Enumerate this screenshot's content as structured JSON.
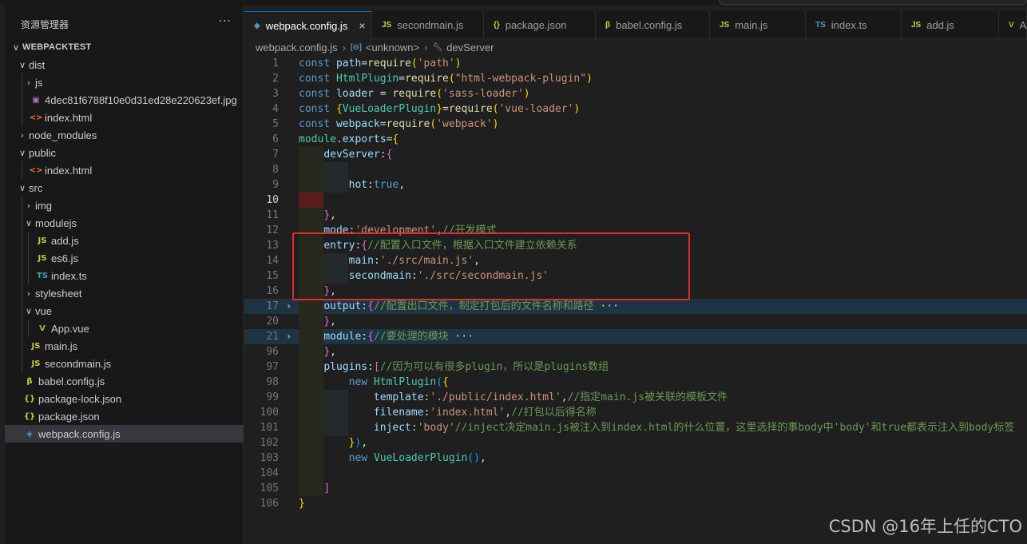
{
  "explorer": {
    "title": "资源管理器",
    "more": "···",
    "tree": [
      {
        "label": "WEBPACKTEST",
        "chev": "∨",
        "icon": "",
        "depth": 0,
        "root": true
      },
      {
        "label": "dist",
        "chev": "∨",
        "icon": "",
        "depth": 1
      },
      {
        "label": "js",
        "chev": "›",
        "icon": "",
        "depth": 2
      },
      {
        "label": "4dec81f6788f10e0d31ed28e220623ef.jpg",
        "chev": "",
        "icon": "▣",
        "iconColor": "#a074c4",
        "depth": 2
      },
      {
        "label": "index.html",
        "chev": "",
        "icon": "<>",
        "iconColor": "#e37933",
        "depth": 2
      },
      {
        "label": "node_modules",
        "chev": "›",
        "icon": "",
        "depth": 1
      },
      {
        "label": "public",
        "chev": "∨",
        "icon": "",
        "depth": 1
      },
      {
        "label": "index.html",
        "chev": "",
        "icon": "<>",
        "iconColor": "#e37933",
        "depth": 2
      },
      {
        "label": "src",
        "chev": "∨",
        "icon": "",
        "depth": 1
      },
      {
        "label": "img",
        "chev": "›",
        "icon": "",
        "depth": 2
      },
      {
        "label": "modulejs",
        "chev": "∨",
        "icon": "",
        "depth": 2
      },
      {
        "label": "add.js",
        "chev": "",
        "icon": "JS",
        "iconColor": "#cbcb41",
        "depth": 3
      },
      {
        "label": "es6.js",
        "chev": "",
        "icon": "JS",
        "iconColor": "#cbcb41",
        "depth": 3
      },
      {
        "label": "index.ts",
        "chev": "",
        "icon": "TS",
        "iconColor": "#519aba",
        "depth": 3
      },
      {
        "label": "stylesheet",
        "chev": "›",
        "icon": "",
        "depth": 2
      },
      {
        "label": "vue",
        "chev": "∨",
        "icon": "",
        "depth": 2
      },
      {
        "label": "App.vue",
        "chev": "",
        "icon": "V",
        "iconColor": "#8dc149",
        "depth": 3
      },
      {
        "label": "main.js",
        "chev": "",
        "icon": "JS",
        "iconColor": "#cbcb41",
        "depth": 2
      },
      {
        "label": "secondmain.js",
        "chev": "",
        "icon": "JS",
        "iconColor": "#cbcb41",
        "depth": 2
      },
      {
        "label": "babel.config.js",
        "chev": "",
        "icon": "β",
        "iconColor": "#cbcb41",
        "depth": 1
      },
      {
        "label": "package-lock.json",
        "chev": "",
        "icon": "{}",
        "iconColor": "#cbcb41",
        "depth": 1
      },
      {
        "label": "package.json",
        "chev": "",
        "icon": "{}",
        "iconColor": "#cbcb41",
        "depth": 1
      },
      {
        "label": "webpack.config.js",
        "chev": "",
        "icon": "◈",
        "iconColor": "#519aba",
        "depth": 1,
        "selected": true
      }
    ]
  },
  "tabs": [
    {
      "label": "webpack.config.js",
      "icon": "◈",
      "iconColor": "#519aba",
      "active": true,
      "close": "×"
    },
    {
      "label": "secondmain.js",
      "icon": "JS",
      "iconColor": "#cbcb41"
    },
    {
      "label": "package.json",
      "icon": "{}",
      "iconColor": "#cbcb41"
    },
    {
      "label": "babel.config.js",
      "icon": "β",
      "iconColor": "#cbcb41"
    },
    {
      "label": "main.js",
      "icon": "JS",
      "iconColor": "#cbcb41"
    },
    {
      "label": "index.ts",
      "icon": "TS",
      "iconColor": "#519aba"
    },
    {
      "label": "add.js",
      "icon": "JS",
      "iconColor": "#cbcb41"
    },
    {
      "label": "A",
      "icon": "V",
      "iconColor": "#8dc149"
    }
  ],
  "breadcrumb": {
    "file": "webpack.config.js",
    "symbol": "<unknown>",
    "prop": "devServer"
  },
  "editor": {
    "current_line": "10",
    "lines": [
      {
        "n": "1",
        "fold": "",
        "tokens": [
          [
            "kw",
            "const "
          ],
          [
            "var",
            "path"
          ],
          [
            "pl",
            "="
          ],
          [
            "fn",
            "require"
          ],
          [
            "br1",
            "("
          ],
          [
            "str",
            "'path'"
          ],
          [
            "br1",
            ")"
          ]
        ]
      },
      {
        "n": "2",
        "fold": "",
        "tokens": [
          [
            "kw",
            "const "
          ],
          [
            "cls",
            "HtmlPlugin"
          ],
          [
            "pl",
            "="
          ],
          [
            "fn",
            "require"
          ],
          [
            "br1",
            "("
          ],
          [
            "str",
            "\"html-webpack-plugin\""
          ],
          [
            "br1",
            ")"
          ]
        ]
      },
      {
        "n": "3",
        "fold": "",
        "tokens": [
          [
            "kw",
            "const "
          ],
          [
            "var",
            "loader"
          ],
          [
            "pl",
            " = "
          ],
          [
            "fn",
            "require"
          ],
          [
            "br1",
            "("
          ],
          [
            "str",
            "'sass-loader'"
          ],
          [
            "br1",
            ")"
          ]
        ]
      },
      {
        "n": "4",
        "fold": "",
        "tokens": [
          [
            "kw",
            "const "
          ],
          [
            "br1",
            "{"
          ],
          [
            "cls",
            "VueLoaderPlugin"
          ],
          [
            "br1",
            "}"
          ],
          [
            "pl",
            "="
          ],
          [
            "fn",
            "require"
          ],
          [
            "br1",
            "("
          ],
          [
            "str",
            "'vue-loader'"
          ],
          [
            "br1",
            ")"
          ]
        ]
      },
      {
        "n": "5",
        "fold": "",
        "tokens": [
          [
            "kw",
            "const "
          ],
          [
            "var",
            "webpack"
          ],
          [
            "pl",
            "="
          ],
          [
            "fn",
            "require"
          ],
          [
            "br1",
            "("
          ],
          [
            "str",
            "'webpack'"
          ],
          [
            "br1",
            ")"
          ]
        ]
      },
      {
        "n": "6",
        "fold": "",
        "tokens": [
          [
            "cls",
            "module"
          ],
          [
            "pl",
            "."
          ],
          [
            "var",
            "exports"
          ],
          [
            "pl",
            "="
          ],
          [
            "br1",
            "{"
          ]
        ]
      },
      {
        "n": "7",
        "fold": "",
        "tokens": [
          [
            "pl",
            "    "
          ],
          [
            "var",
            "devServer"
          ],
          [
            "pl",
            ":"
          ],
          [
            "br2",
            "{"
          ]
        ]
      },
      {
        "n": "8",
        "fold": "",
        "tokens": []
      },
      {
        "n": "9",
        "fold": "",
        "tokens": [
          [
            "pl",
            "        "
          ],
          [
            "var",
            "hot"
          ],
          [
            "pl",
            ":"
          ],
          [
            "kw",
            "true"
          ],
          [
            "pl",
            ","
          ]
        ]
      },
      {
        "n": "10",
        "fold": "",
        "tokens": []
      },
      {
        "n": "11",
        "fold": "",
        "tokens": [
          [
            "pl",
            "    "
          ],
          [
            "br2",
            "}"
          ],
          [
            "pl",
            ","
          ]
        ]
      },
      {
        "n": "12",
        "fold": "",
        "tokens": [
          [
            "pl",
            "    "
          ],
          [
            "var",
            "mode"
          ],
          [
            "pl",
            ":"
          ],
          [
            "str",
            "'development'"
          ],
          [
            "pl",
            ","
          ],
          [
            "cmt",
            "//开发模式"
          ]
        ]
      },
      {
        "n": "13",
        "fold": "",
        "tokens": [
          [
            "pl",
            "    "
          ],
          [
            "var",
            "entry"
          ],
          [
            "pl",
            ":"
          ],
          [
            "br2",
            "{"
          ],
          [
            "cmt",
            "//配置入口文件，根据入口文件建立依赖关系"
          ]
        ]
      },
      {
        "n": "14",
        "fold": "",
        "tokens": [
          [
            "pl",
            "        "
          ],
          [
            "var",
            "main"
          ],
          [
            "pl",
            ":"
          ],
          [
            "str",
            "'./src/main.js'"
          ],
          [
            "pl",
            ","
          ]
        ]
      },
      {
        "n": "15",
        "fold": "",
        "tokens": [
          [
            "pl",
            "        "
          ],
          [
            "var",
            "secondmain"
          ],
          [
            "pl",
            ":"
          ],
          [
            "str",
            "'./src/secondmain.js'"
          ]
        ]
      },
      {
        "n": "16",
        "fold": "",
        "tokens": [
          [
            "pl",
            "    "
          ],
          [
            "br2",
            "}"
          ],
          [
            "pl",
            ","
          ]
        ]
      },
      {
        "n": "17",
        "fold": "›",
        "hl": true,
        "tokens": [
          [
            "pl",
            "    "
          ],
          [
            "var",
            "output"
          ],
          [
            "pl",
            ":"
          ],
          [
            "br2",
            "{"
          ],
          [
            "cmt",
            "//配置出口文件，制定打包后的文件名称和路径"
          ],
          [
            "pl",
            " ···"
          ]
        ]
      },
      {
        "n": "20",
        "fold": "",
        "tokens": [
          [
            "pl",
            "    "
          ],
          [
            "br2",
            "}"
          ],
          [
            "pl",
            ","
          ]
        ]
      },
      {
        "n": "21",
        "fold": "›",
        "hl": true,
        "tokens": [
          [
            "pl",
            "    "
          ],
          [
            "var",
            "module"
          ],
          [
            "pl",
            ":"
          ],
          [
            "br2",
            "{"
          ],
          [
            "cmt",
            "//要处理的模块"
          ],
          [
            "pl",
            " ···"
          ]
        ]
      },
      {
        "n": "96",
        "fold": "",
        "tokens": [
          [
            "pl",
            "    "
          ],
          [
            "br2",
            "}"
          ],
          [
            "pl",
            ","
          ]
        ]
      },
      {
        "n": "97",
        "fold": "",
        "tokens": [
          [
            "pl",
            "    "
          ],
          [
            "var",
            "plugins"
          ],
          [
            "pl",
            ":"
          ],
          [
            "br2",
            "["
          ],
          [
            "cmt",
            "//因为可以有很多plugin，所以是plugins数组"
          ]
        ]
      },
      {
        "n": "98",
        "fold": "",
        "tokens": [
          [
            "pl",
            "        "
          ],
          [
            "kw",
            "new "
          ],
          [
            "cls",
            "HtmlPlugin"
          ],
          [
            "br3",
            "("
          ],
          [
            "br1",
            "{"
          ]
        ]
      },
      {
        "n": "99",
        "fold": "",
        "tokens": [
          [
            "pl",
            "            "
          ],
          [
            "var",
            "template"
          ],
          [
            "pl",
            ":"
          ],
          [
            "str",
            "'./public/index.html'"
          ],
          [
            "pl",
            ","
          ],
          [
            "cmt",
            "//指定main.js被关联的模板文件"
          ]
        ]
      },
      {
        "n": "100",
        "fold": "",
        "tokens": [
          [
            "pl",
            "            "
          ],
          [
            "var",
            "filename"
          ],
          [
            "pl",
            ":"
          ],
          [
            "str",
            "'index.html'"
          ],
          [
            "pl",
            ","
          ],
          [
            "cmt",
            "//打包以后得名称"
          ]
        ]
      },
      {
        "n": "101",
        "fold": "",
        "tokens": [
          [
            "pl",
            "            "
          ],
          [
            "var",
            "inject"
          ],
          [
            "pl",
            ":"
          ],
          [
            "str",
            "'body'"
          ],
          [
            "cmt",
            "//inject决定main.js被注入到index.html的什么位置，这里选择的事body中'body'和true都表示注入到body标签"
          ]
        ]
      },
      {
        "n": "102",
        "fold": "",
        "tokens": [
          [
            "pl",
            "        "
          ],
          [
            "br1",
            "}"
          ],
          [
            "br3",
            ")"
          ],
          [
            "pl",
            ","
          ]
        ]
      },
      {
        "n": "103",
        "fold": "",
        "tokens": [
          [
            "pl",
            "        "
          ],
          [
            "kw",
            "new "
          ],
          [
            "cls",
            "VueLoaderPlugin"
          ],
          [
            "br3",
            "("
          ],
          [
            "br3",
            ")"
          ],
          [
            "pl",
            ","
          ]
        ]
      },
      {
        "n": "104",
        "fold": "",
        "tokens": []
      },
      {
        "n": "105",
        "fold": "",
        "tokens": [
          [
            "pl",
            "    "
          ],
          [
            "br2",
            "]"
          ]
        ]
      },
      {
        "n": "106",
        "fold": "",
        "tokens": [
          [
            "br1",
            "}"
          ]
        ]
      }
    ]
  },
  "watermark": "CSDN @16年上任的CTO",
  "colors": {
    "accent": "#0078d4",
    "highlight_box": "#e52a2a"
  }
}
